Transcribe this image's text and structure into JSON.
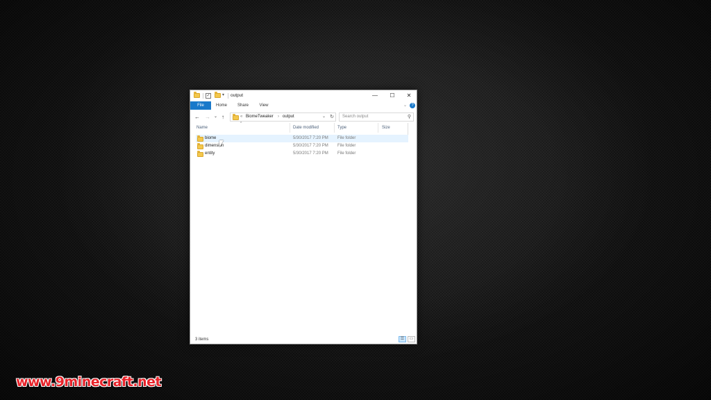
{
  "window": {
    "title": "output",
    "qat_dropdown": "▾",
    "minimize": "—",
    "maximize": "☐",
    "close": "✕"
  },
  "ribbon": {
    "tabs": [
      "File",
      "Home",
      "Share",
      "View"
    ],
    "expand": "⌄",
    "help": "?"
  },
  "nav": {
    "back": "←",
    "forward": "→",
    "recent": "⌄",
    "up": "↑",
    "overflow": "«",
    "breadcrumb": [
      "BiomeTweaker",
      "output"
    ],
    "breadcrumb_sep": "›",
    "dropdown": "⌄",
    "refresh": "↻"
  },
  "search": {
    "placeholder": "Search output",
    "icon": "⚲"
  },
  "columns": {
    "name": "Name",
    "date": "Date modified",
    "type": "Type",
    "size": "Size",
    "sort_indicator": "^"
  },
  "files": [
    {
      "name": "biome",
      "date": "5/30/2017 7:20 PM",
      "type": "File folder"
    },
    {
      "name": "dimension",
      "date": "5/30/2017 7:20 PM",
      "type": "File folder"
    },
    {
      "name": "entity",
      "date": "5/30/2017 7:20 PM",
      "type": "File folder"
    }
  ],
  "status": {
    "item_count": "3 items"
  },
  "watermark": "www.9minecraft.net",
  "colors": {
    "accent": "#1979ca",
    "folder": "#f3c74c",
    "row_hover": "#e5f3ff",
    "watermark": "#e8232a"
  }
}
